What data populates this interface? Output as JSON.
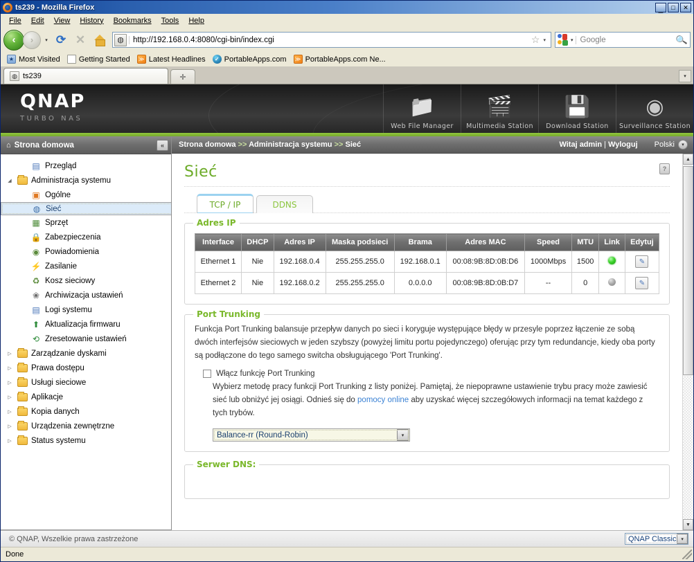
{
  "browser": {
    "title": "ts239 - Mozilla Firefox",
    "window_buttons": {
      "minimize": "_",
      "maximize": "□",
      "close": "✕"
    },
    "menus": [
      "File",
      "Edit",
      "View",
      "History",
      "Bookmarks",
      "Tools",
      "Help"
    ],
    "nav": {
      "back_label": "‹",
      "forward_label": "›",
      "dropdown_label": "▾",
      "reload_label": "⟳",
      "stop_label": "✕",
      "home_label": "home-icon"
    },
    "url": "http://192.168.0.4:8080/cgi-bin/index.cgi",
    "url_star": "☆",
    "url_dropdown": "▾",
    "search_placeholder": "Google",
    "search_engine": "Google",
    "bookmarks": [
      {
        "label": "Most Visited",
        "icon": "star-folder-icon"
      },
      {
        "label": "Getting Started",
        "icon": "page-icon"
      },
      {
        "label": "Latest Headlines",
        "icon": "rss-icon"
      },
      {
        "label": "PortableApps.com",
        "icon": "check-circle-icon"
      },
      {
        "label": "PortableApps.com Ne...",
        "icon": "rss-icon"
      }
    ],
    "tabs": [
      {
        "label": "ts239",
        "active": true
      }
    ],
    "new_tab_label": "✛",
    "tab_list_label": "▾",
    "status": "Done"
  },
  "banner": {
    "brand": "QNAP",
    "subtitle": "TURBO NAS",
    "stations": [
      {
        "label": "Web File Manager",
        "icon": "folder-search-icon",
        "glyph": "🗀"
      },
      {
        "label": "Multimedia Station",
        "icon": "media-icon",
        "glyph": "🎞"
      },
      {
        "label": "Download Station",
        "icon": "download-icon",
        "glyph": "⬇"
      },
      {
        "label": "Surveillance Station",
        "icon": "camera-icon",
        "glyph": "◉"
      }
    ]
  },
  "sidebar": {
    "header": "Strona domowa",
    "home_icon": "⌂",
    "collapse_label": "«",
    "items": [
      {
        "label": "Przegląd",
        "level": 1,
        "type": "leaf",
        "icon": "overview-icon",
        "glyph": "▤",
        "color": "#4a76b8",
        "selected": false,
        "twisty": ""
      },
      {
        "label": "Administracja systemu",
        "level": 0,
        "type": "folder-open",
        "icon": "folder-open-icon",
        "glyph": "",
        "selected": false,
        "twisty": "◢"
      },
      {
        "label": "Ogólne",
        "level": 1,
        "type": "leaf",
        "icon": "general-icon",
        "glyph": "▣",
        "color": "#e07820",
        "selected": false,
        "twisty": ""
      },
      {
        "label": "Sieć",
        "level": 1,
        "type": "leaf",
        "icon": "network-icon",
        "glyph": "◍",
        "color": "#3f6fa8",
        "selected": true,
        "twisty": ""
      },
      {
        "label": "Sprzęt",
        "level": 1,
        "type": "leaf",
        "icon": "hardware-icon",
        "glyph": "▦",
        "color": "#4e8c3a",
        "selected": false,
        "twisty": ""
      },
      {
        "label": "Zabezpieczenia",
        "level": 1,
        "type": "leaf",
        "icon": "security-lock-icon",
        "glyph": "🔒",
        "color": "#8a8a8a",
        "selected": false,
        "twisty": ""
      },
      {
        "label": "Powiadomienia",
        "level": 1,
        "type": "leaf",
        "icon": "notification-icon",
        "glyph": "◉",
        "color": "#5a8a3a",
        "selected": false,
        "twisty": ""
      },
      {
        "label": "Zasilanie",
        "level": 1,
        "type": "leaf",
        "icon": "power-icon",
        "glyph": "⚡",
        "color": "#d8a020",
        "selected": false,
        "twisty": ""
      },
      {
        "label": "Kosz sieciowy",
        "level": 1,
        "type": "leaf",
        "icon": "recycle-bin-icon",
        "glyph": "♻",
        "color": "#5a8a3a",
        "selected": false,
        "twisty": ""
      },
      {
        "label": "Archiwizacja ustawień",
        "level": 1,
        "type": "leaf",
        "icon": "backup-icon",
        "glyph": "❀",
        "color": "#6a6a6a",
        "selected": false,
        "twisty": ""
      },
      {
        "label": "Logi systemu",
        "level": 1,
        "type": "leaf",
        "icon": "system-log-icon",
        "glyph": "▤",
        "color": "#4a76b8",
        "selected": false,
        "twisty": ""
      },
      {
        "label": "Aktualizacja firmwaru",
        "level": 1,
        "type": "leaf",
        "icon": "firmware-update-icon",
        "glyph": "⬆",
        "color": "#2e8b3a",
        "selected": false,
        "twisty": ""
      },
      {
        "label": "Zresetowanie ustawień",
        "level": 1,
        "type": "leaf",
        "icon": "reset-settings-icon",
        "glyph": "⟲",
        "color": "#2e8b3a",
        "selected": false,
        "twisty": ""
      },
      {
        "label": "Zarządzanie dyskami",
        "level": 0,
        "type": "folder",
        "icon": "folder-icon",
        "glyph": "",
        "selected": false,
        "twisty": "▷"
      },
      {
        "label": "Prawa dostępu",
        "level": 0,
        "type": "folder",
        "icon": "folder-icon",
        "glyph": "",
        "selected": false,
        "twisty": "▷"
      },
      {
        "label": "Usługi sieciowe",
        "level": 0,
        "type": "folder",
        "icon": "folder-icon",
        "glyph": "",
        "selected": false,
        "twisty": "▷"
      },
      {
        "label": "Aplikacje",
        "level": 0,
        "type": "folder",
        "icon": "folder-icon",
        "glyph": "",
        "selected": false,
        "twisty": "▷"
      },
      {
        "label": "Kopia danych",
        "level": 0,
        "type": "folder",
        "icon": "folder-icon",
        "glyph": "",
        "selected": false,
        "twisty": "▷"
      },
      {
        "label": "Urządzenia zewnętrzne",
        "level": 0,
        "type": "folder",
        "icon": "folder-icon",
        "glyph": "",
        "selected": false,
        "twisty": "▷"
      },
      {
        "label": "Status systemu",
        "level": 0,
        "type": "folder",
        "icon": "folder-icon",
        "glyph": "",
        "selected": false,
        "twisty": "▷"
      }
    ]
  },
  "topbar": {
    "breadcrumb": "Strona domowa >> Administracja systemu >> Sieć",
    "greeting": "Witaj admin",
    "separator": "|",
    "logout": "Wyloguj",
    "language": "Polski",
    "language_caret": "▾"
  },
  "page": {
    "title": "Sieć",
    "help_label": "?",
    "tabs": [
      {
        "label": "TCP / IP",
        "active": true
      },
      {
        "label": "DDNS",
        "active": false
      }
    ]
  },
  "ip_section": {
    "legend": "Adres IP",
    "columns": [
      "Interface",
      "DHCP",
      "Adres IP",
      "Maska podsieci",
      "Brama",
      "Adres MAC",
      "Speed",
      "MTU",
      "Link",
      "Edytuj"
    ],
    "rows": [
      {
        "interface": "Ethernet 1",
        "dhcp": "Nie",
        "ip": "192.168.0.4",
        "mask": "255.255.255.0",
        "gateway": "192.168.0.1",
        "mac": "00:08:9B:8D:0B:D6",
        "speed": "1000Mbps",
        "mtu": "1500",
        "link": "on",
        "edit": "✎"
      },
      {
        "interface": "Ethernet 2",
        "dhcp": "Nie",
        "ip": "192.168.0.2",
        "mask": "255.255.255.0",
        "gateway": "0.0.0.0",
        "mac": "00:08:9B:8D:0B:D7",
        "speed": "--",
        "mtu": "0",
        "link": "off",
        "edit": "✎"
      }
    ]
  },
  "trunking_section": {
    "legend": "Port Trunking",
    "description": "Funkcja Port Trunking balansuje przepływ danych po sieci i koryguje występujące błędy w przesyle poprzez łączenie ze sobą dwóch interfejsów sieciowych w jeden szybszy (powyżej limitu portu pojedynczego) oferując przy tym redundancje, kiedy oba porty są podłączone do tego samego switcha obsługującego 'Port Trunking'.",
    "checkbox_label": "Włącz funkcję Port Trunking",
    "checkbox_checked": false,
    "hint_before_link": "Wybierz metodę pracy funkcji Port Trunking z listy poniżej. Pamiętaj, że niepoprawne ustawienie trybu pracy może zawiesić sieć lub obniżyć jej osiągi. Odnieś się do ",
    "hint_link": "pomocy online",
    "hint_after_link": " aby uzyskać więcej szczegółowych informacji na temat każdego z tych trybów.",
    "select_value": "Balance-rr  (Round-Robin)",
    "select_caret": "▾"
  },
  "dns_section": {
    "legend": "Serwer DNS:"
  },
  "footer": {
    "copyright": "© QNAP, Wszelkie prawa zastrzeżone",
    "skin": "QNAP Classic",
    "skin_caret": "▾"
  },
  "colors": {
    "qnap_green": "#8DC63F",
    "title_green": "#6CAB28",
    "link_blue": "#3B82D4",
    "selection_blue": "#DCEBF9"
  }
}
